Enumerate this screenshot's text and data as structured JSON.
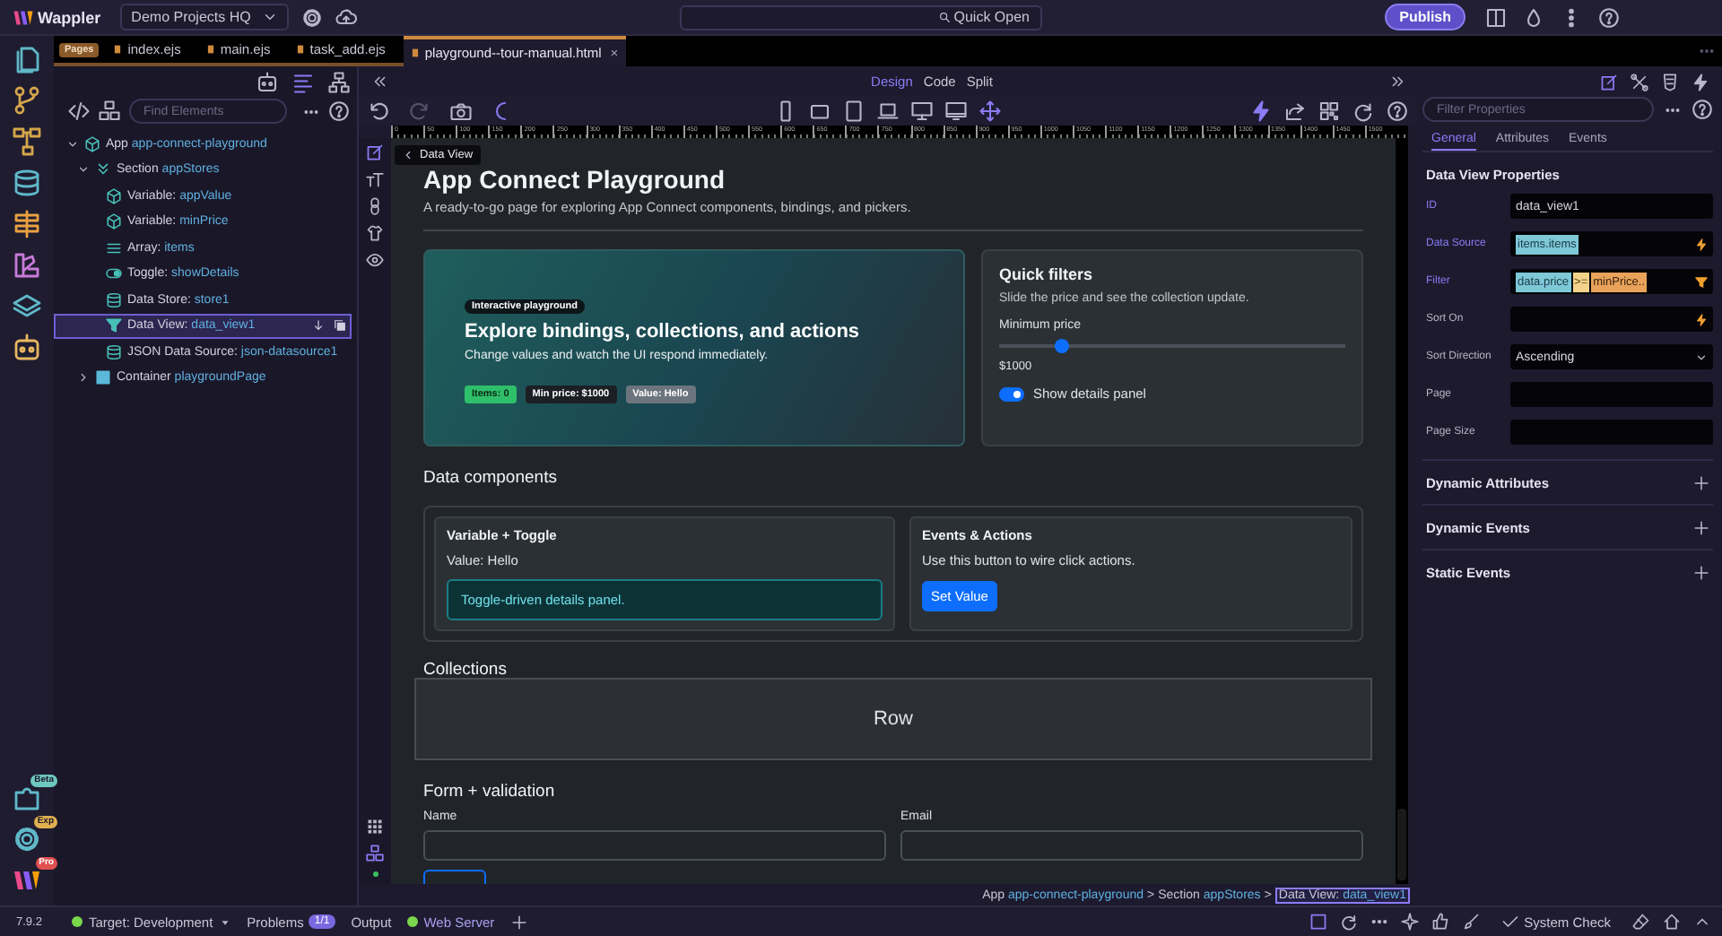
{
  "topbar": {
    "logo": "Wappler",
    "project": "Demo Projects HQ",
    "quick_open": "Quick Open",
    "publish": "Publish"
  },
  "rail_badges": [
    "Beta",
    "Exp",
    "Pro"
  ],
  "tabs": {
    "group_label": "Pages",
    "items": [
      {
        "label": "index.ejs",
        "selected": false
      },
      {
        "label": "main.ejs",
        "selected": false
      },
      {
        "label": "task_add.ejs",
        "selected": false
      },
      {
        "label": "playground--tour-manual.html",
        "selected": true,
        "close": "×"
      }
    ]
  },
  "tree_panel": {
    "search_placeholder": "Find Elements"
  },
  "tree": [
    {
      "type": "App",
      "name": "app-connect-playground",
      "kind": "app",
      "expanded": true,
      "selected": false,
      "children": [
        {
          "type": "Section",
          "name": "appStores",
          "kind": "section",
          "expanded": true,
          "selected": false,
          "children": [
            {
              "type": "Variable:",
              "name": "appValue",
              "kind": "variable",
              "selected": false
            },
            {
              "type": "Variable:",
              "name": "minPrice",
              "kind": "variable",
              "selected": false
            },
            {
              "type": "Array:",
              "name": "items",
              "kind": "array",
              "selected": false
            },
            {
              "type": "Toggle:",
              "name": "showDetails",
              "kind": "toggle",
              "selected": false
            },
            {
              "type": "Data Store:",
              "name": "store1",
              "kind": "datastore",
              "selected": false
            },
            {
              "type": "Data View:",
              "name": "data_view1",
              "kind": "dataview",
              "selected": true
            },
            {
              "type": "JSON Data Source:",
              "name": "json-datasource1",
              "kind": "json",
              "selected": false
            }
          ]
        },
        {
          "type": "Container",
          "name": "playgroundPage",
          "kind": "container",
          "expanded": false,
          "selected": false
        }
      ]
    }
  ],
  "design": {
    "modes": [
      {
        "label": "Design",
        "selected": true
      },
      {
        "label": "Code",
        "selected": false
      },
      {
        "label": "Split",
        "selected": false
      }
    ],
    "ruler": [
      "0",
      "50",
      "100",
      "150",
      "200",
      "250",
      "300",
      "350",
      "400",
      "450",
      "500",
      "550",
      "600",
      "650",
      "700",
      "750",
      "800",
      "850",
      "900",
      "950",
      "1000",
      "1050",
      "1100",
      "1150",
      "1200",
      "1250",
      "1300",
      "1350",
      "1400",
      "1450",
      "1500"
    ]
  },
  "canvas": {
    "crumb": "Data View",
    "title": "App Connect Playground",
    "subtitle": "A ready-to-go page for exploring App Connect components, bindings, and pickers.",
    "hero": {
      "eyebrow": "Interactive playground",
      "heading": "Explore bindings, collections, and actions",
      "text": "Change values and watch the UI respond immediately.",
      "badges": [
        {
          "label": "Items: 0",
          "kind": "success"
        },
        {
          "label": "Min price: $1000",
          "kind": "dark"
        },
        {
          "label": "Value: Hello",
          "kind": "secondary"
        }
      ]
    },
    "filters": {
      "title": "Quick filters",
      "text": "Slide the price and see the collection update.",
      "slider_label": "Minimum price",
      "level": 0.18,
      "value": "$1000",
      "toggle_label": "Show details panel",
      "on": true
    },
    "data_components": {
      "heading": "Data components",
      "variable_card": {
        "title": "Variable + Toggle",
        "value": "Value: Hello",
        "details": "Toggle-driven details panel."
      },
      "events_card": {
        "title": "Events & Actions",
        "text": "Use this button to wire click actions.",
        "button": "Set Value"
      }
    },
    "collections": {
      "heading": "Collections",
      "overlay": "Row"
    },
    "form": {
      "heading": "Form + validation",
      "fields": [
        {
          "label": "Name"
        },
        {
          "label": "Email"
        }
      ]
    }
  },
  "breadcrumb": [
    {
      "type": "App",
      "name": "app-connect-playground",
      "separator": ">",
      "selected": false
    },
    {
      "type": "Section",
      "name": "appStores",
      "separator": ">",
      "selected": false
    },
    {
      "type": "Data View:",
      "name": "data_view1",
      "selected": true
    }
  ],
  "properties": {
    "search_placeholder": "Filter Properties",
    "tabs": [
      {
        "label": "General",
        "selected": true
      },
      {
        "label": "Attributes",
        "selected": false
      },
      {
        "label": "Events",
        "selected": false
      }
    ],
    "title": "Data View Properties",
    "rows": [
      {
        "label": "ID",
        "set": true,
        "kind": "text",
        "value": "data_view1"
      },
      {
        "label": "Data Source",
        "set": true,
        "kind": "binding",
        "chips": [
          {
            "text": "items.items",
            "kind": "value"
          }
        ]
      },
      {
        "label": "Filter",
        "set": true,
        "kind": "filter",
        "chips": [
          {
            "text": "data.price",
            "kind": "value"
          },
          {
            "text": ">=",
            "kind": "operator"
          },
          {
            "text": "minPrice..",
            "kind": "variable"
          }
        ]
      },
      {
        "label": "Sort On",
        "set": false,
        "kind": "binding"
      },
      {
        "label": "Sort Direction",
        "set": false,
        "kind": "select",
        "value": "Ascending"
      },
      {
        "label": "Page",
        "set": false,
        "kind": "text"
      },
      {
        "label": "Page Size",
        "set": false,
        "kind": "text"
      }
    ],
    "sections": [
      "Dynamic Attributes",
      "Dynamic Events",
      "Static Events"
    ]
  },
  "status": {
    "version": "7.9.2",
    "target": {
      "label": "Target: Development",
      "ok": true
    },
    "problems": {
      "label": "Problems",
      "count": "1/1"
    },
    "output": "Output",
    "web_server": {
      "label": "Web Server",
      "running": true
    },
    "system_check": "System Check"
  }
}
